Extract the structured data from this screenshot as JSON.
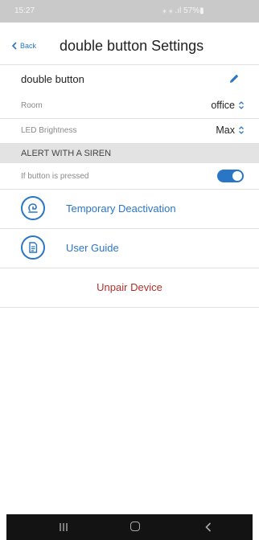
{
  "status_bar": {
    "time": "15:27",
    "system": "⁎ ⁎ .ıl 57%▮"
  },
  "header": {
    "back_label": "Back",
    "title": "double button Settings"
  },
  "device": {
    "name": "double button"
  },
  "settings": {
    "room_label": "Room",
    "room_value": "office",
    "led_label": "LED Brightness",
    "led_value": "Max"
  },
  "alert": {
    "section_title": "ALERT WITH A SIREN",
    "pressed_label": "If button is pressed",
    "pressed_enabled": true
  },
  "actions": {
    "temporary_deactivation": "Temporary Deactivation",
    "user_guide": "User Guide",
    "unpair": "Unpair Device"
  },
  "colors": {
    "accent": "#2a76c6",
    "danger": "#b3302a",
    "section_bg": "#e3e3e3"
  },
  "icons": [
    "chevron-left-icon",
    "pencil-icon",
    "updown-icon",
    "siren-icon",
    "document-icon",
    "recent-apps-icon",
    "home-icon",
    "back-icon"
  ]
}
